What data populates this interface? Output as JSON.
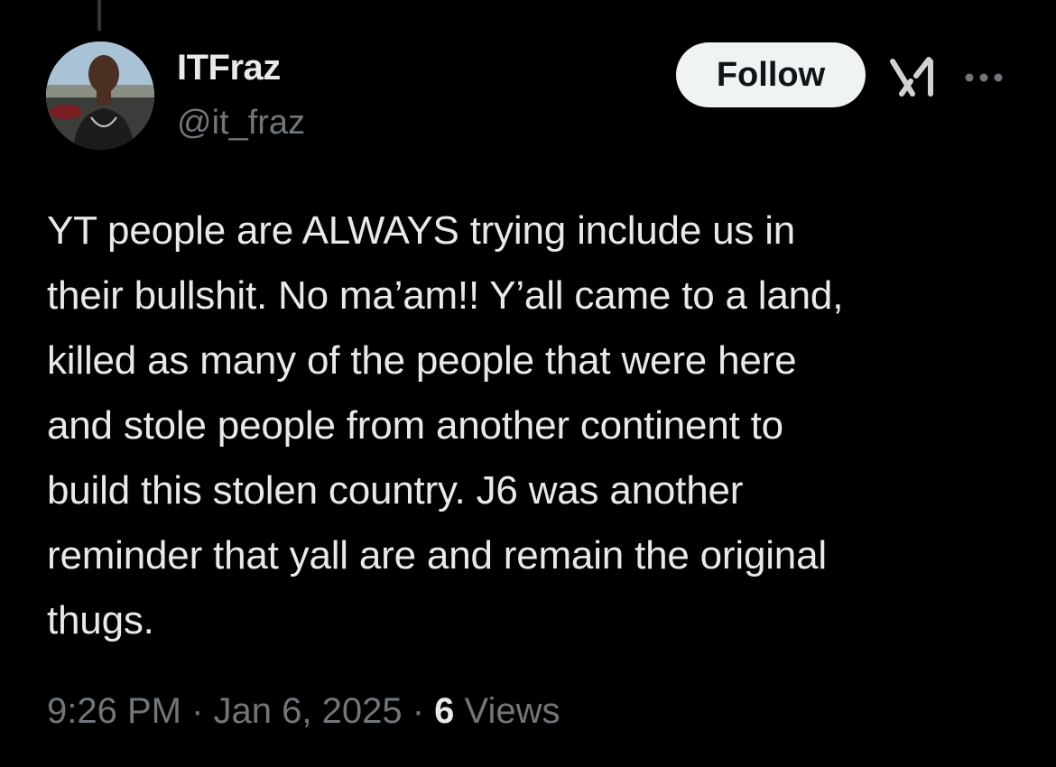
{
  "tweet": {
    "author": {
      "display_name": "ITFraz",
      "handle": "@it_fraz"
    },
    "follow_label": "Follow",
    "text": "YT people are ALWAYS trying include us in\ntheir bullshit. No ma’am!! Y’all came to a land,\nkilled as many of the people that were here\nand stole people from another continent to\nbuild this stolen country. J6 was another\nreminder that yall are and remain the original\nthugs.",
    "time": "9:26 PM",
    "separator": " · ",
    "date": "Jan 6, 2025",
    "views_count": "6",
    "views_label": " Views"
  },
  "icons": {
    "grok": "grok-icon",
    "more": "more-icon"
  },
  "colors": {
    "background": "#000000",
    "primary_text": "#e7e9ea",
    "secondary_text": "#71767b",
    "follow_bg": "#eff3f4",
    "follow_text": "#0f1419"
  }
}
